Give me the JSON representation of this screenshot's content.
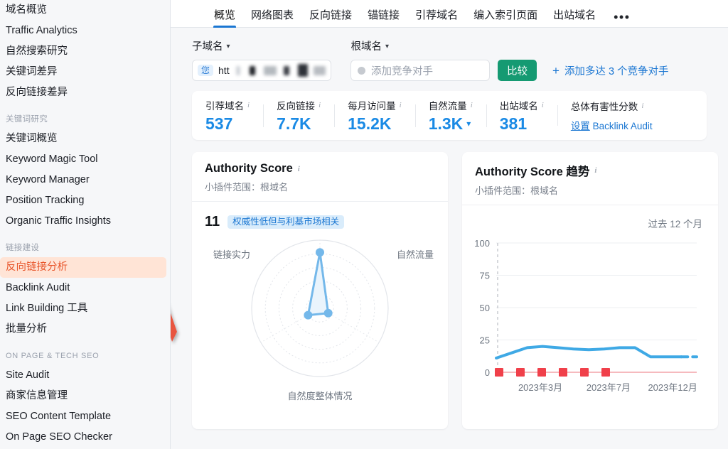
{
  "sidebar": {
    "items_top": [
      {
        "label": "域名概览",
        "active": false
      },
      {
        "label": "Traffic Analytics",
        "active": false
      },
      {
        "label": "自然搜索研究",
        "active": false
      },
      {
        "label": "关键词差异",
        "active": false
      },
      {
        "label": "反向链接差异",
        "active": false
      }
    ],
    "group_keyword": "关键词研究",
    "items_keyword": [
      {
        "label": "关键词概览",
        "active": false
      },
      {
        "label": "Keyword Magic Tool",
        "active": false
      },
      {
        "label": "Keyword Manager",
        "active": false
      },
      {
        "label": "Position Tracking",
        "active": false
      },
      {
        "label": "Organic Traffic Insights",
        "active": false
      }
    ],
    "group_link": "链接建设",
    "items_link": [
      {
        "label": "反向链接分析",
        "active": true
      },
      {
        "label": "Backlink Audit",
        "active": false
      },
      {
        "label": "Link Building 工具",
        "active": false
      },
      {
        "label": "批量分析",
        "active": false
      }
    ],
    "group_onpage": "ON PAGE & TECH SEO",
    "items_onpage": [
      {
        "label": "Site Audit",
        "active": false
      },
      {
        "label": "商家信息管理",
        "active": false
      },
      {
        "label": "SEO Content Template",
        "active": false
      },
      {
        "label": "On Page SEO Checker",
        "active": false
      }
    ]
  },
  "tabs": [
    {
      "label": "概览",
      "active": true
    },
    {
      "label": "网络图表",
      "active": false
    },
    {
      "label": "反向链接",
      "active": false
    },
    {
      "label": "锚链接",
      "active": false
    },
    {
      "label": "引荐域名",
      "active": false
    },
    {
      "label": "编入索引页面",
      "active": false
    },
    {
      "label": "出站域名",
      "active": false
    }
  ],
  "tabs_more": "•••",
  "toolbar": {
    "scope_label": "子域名",
    "root_label": "根域名",
    "domain_badge": "您",
    "domain_value": "htt",
    "competitor_placeholder": "添加竞争对手",
    "compare_button": "比较",
    "add_competitors": "添加多达 3 个竞争对手",
    "add_plus": "+"
  },
  "metrics": [
    {
      "label": "引荐域名",
      "value": "537",
      "has_chevron": false
    },
    {
      "label": "反向链接",
      "value": "7.7K",
      "has_chevron": false
    },
    {
      "label": "每月访问量",
      "value": "15.2K",
      "has_chevron": false
    },
    {
      "label": "自然流量",
      "value": "1.3K",
      "has_chevron": true
    },
    {
      "label": "出站域名",
      "value": "381",
      "has_chevron": false
    }
  ],
  "harmful": {
    "label": "总体有害性分数",
    "link_prefix": "设置",
    "link_text": "Backlink Audit"
  },
  "authority_card": {
    "title": "Authority Score",
    "subtitle": "小插件范围：根域名",
    "score": "11",
    "tag": "权威性低但与利基市场相关"
  },
  "trend_card": {
    "title": "Authority Score 趋势",
    "subtitle": "小插件范围：根域名",
    "period": "过去 12 个月"
  },
  "chart_data": [
    {
      "type": "radar",
      "title": "Authority Score",
      "axes": [
        "链接实力",
        "自然流量",
        "自然度整体情况"
      ],
      "values": [
        14,
        20,
        82
      ],
      "max": 100,
      "rings": 5,
      "color": "#74b8ea",
      "fill": "#eaf4fc"
    },
    {
      "type": "line",
      "title": "Authority Score 趋势",
      "xlabel": "",
      "ylabel": "",
      "ylim": [
        0,
        100
      ],
      "yticks": [
        0,
        25,
        50,
        75,
        100
      ],
      "xtick_labels": [
        "2023年3月",
        "2023年7月",
        "2023年12月"
      ],
      "xtick_positions": [
        0.22,
        0.56,
        0.88
      ],
      "grid": true,
      "legend": "none",
      "series": [
        {
          "name": "Authority Score",
          "color": "#3fa9e5",
          "values": [
            11,
            15,
            19,
            20,
            19,
            18,
            17.5,
            18,
            19,
            19,
            12,
            12,
            12,
            12
          ],
          "dashed_from": 12
        },
        {
          "name": "Toxicity markers",
          "color": "#f0404a",
          "type": "marker",
          "marker": "square",
          "values": [
            0,
            0,
            0,
            0,
            0,
            0
          ],
          "count": 6
        }
      ]
    }
  ]
}
